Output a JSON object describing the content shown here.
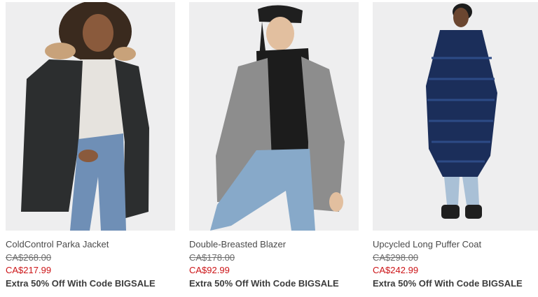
{
  "colors": {
    "sale_price": "#cc1417",
    "original_price": "#6d6d6d",
    "product_name": "#4a4a4a",
    "promo": "#3c3c3c",
    "photo_background": "#eeeeef"
  },
  "products": [
    {
      "name": "ColdControl Parka Jacket",
      "original_price": "CA$268.00",
      "sale_price": "CA$217.99",
      "promo": "Extra 50% Off With Code BIGSALE"
    },
    {
      "name": "Double-Breasted Blazer",
      "original_price": "CA$178.00",
      "sale_price": "CA$92.99",
      "promo": "Extra 50% Off With Code BIGSALE"
    },
    {
      "name": "Upcycled Long Puffer Coat",
      "original_price": "CA$298.00",
      "sale_price": "CA$242.99",
      "promo": "Extra 50% Off With Code BIGSALE"
    }
  ]
}
